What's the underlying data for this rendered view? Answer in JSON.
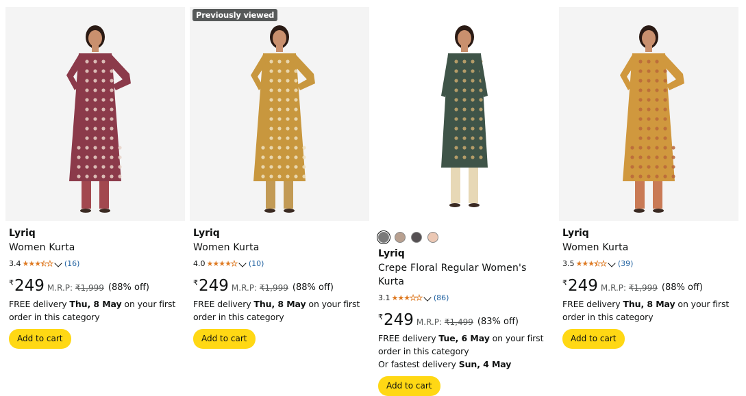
{
  "cards": [
    {
      "badge": "",
      "brand": "Lyriq",
      "title": "Women Kurta",
      "rating": "3.4",
      "rating_value": 3.4,
      "review_count": "(16)",
      "currency": "₹",
      "price": "249",
      "mrp_label": "M.R.P:",
      "mrp": "₹1,999",
      "discount": "(88% off)",
      "delivery_prefix": "FREE delivery",
      "delivery_date": "Thu, 8 May",
      "delivery_suffix": "on your first order in this category",
      "fastest_prefix": "",
      "fastest_date": "",
      "add_to_cart": "Add to cart",
      "colors": {
        "top": "#8b3a4a",
        "pattern": "#e8d2c8",
        "pants": "#a2484f",
        "bg": "#f4f4f4"
      }
    },
    {
      "badge": "Previously viewed",
      "brand": "Lyriq",
      "title": "Women Kurta",
      "rating": "4.0",
      "rating_value": 4.0,
      "review_count": "(10)",
      "currency": "₹",
      "price": "249",
      "mrp_label": "M.R.P:",
      "mrp": "₹1,999",
      "discount": "(88% off)",
      "delivery_prefix": "FREE delivery",
      "delivery_date": "Thu, 8 May",
      "delivery_suffix": "on your first order in this category",
      "fastest_prefix": "",
      "fastest_date": "",
      "add_to_cart": "Add to cart",
      "colors": {
        "top": "#c8973e",
        "pattern": "#efe0c0",
        "pants": "#c29a55",
        "bg": "#f4f4f4"
      }
    },
    {
      "badge": "",
      "brand": "Lyriq",
      "title": "Crepe Floral Regular Women's Kurta",
      "rating": "3.1",
      "rating_value": 3.1,
      "review_count": "(86)",
      "currency": "₹",
      "price": "249",
      "mrp_label": "M.R.P:",
      "mrp": "₹1,499",
      "discount": "(83% off)",
      "delivery_prefix": "FREE delivery",
      "delivery_date": "Tue, 6 May",
      "delivery_suffix": "on your first order in this category",
      "fastest_prefix": "Or fastest delivery",
      "fastest_date": "Sun, 4 May",
      "add_to_cart": "Add to cart",
      "swatches": [
        "#7a7a7a",
        "#b8a090",
        "#555053",
        "#ecc8b4"
      ],
      "colors": {
        "top": "#3f5448",
        "pattern": "#c9a96e",
        "pants": "#e7d8b6",
        "bg": "#ffffff"
      }
    },
    {
      "badge": "",
      "brand": "Lyriq",
      "title": "Women Kurta",
      "rating": "3.5",
      "rating_value": 3.5,
      "review_count": "(39)",
      "currency": "₹",
      "price": "249",
      "mrp_label": "M.R.P:",
      "mrp": "₹1,999",
      "discount": "(88% off)",
      "delivery_prefix": "FREE delivery",
      "delivery_date": "Thu, 8 May",
      "delivery_suffix": "on your first order in this category",
      "fastest_prefix": "",
      "fastest_date": "",
      "add_to_cart": "Add to cart",
      "colors": {
        "top": "#d0983e",
        "pattern": "#b8663a",
        "pants": "#c97a55",
        "bg": "#f4f4f4"
      }
    }
  ]
}
